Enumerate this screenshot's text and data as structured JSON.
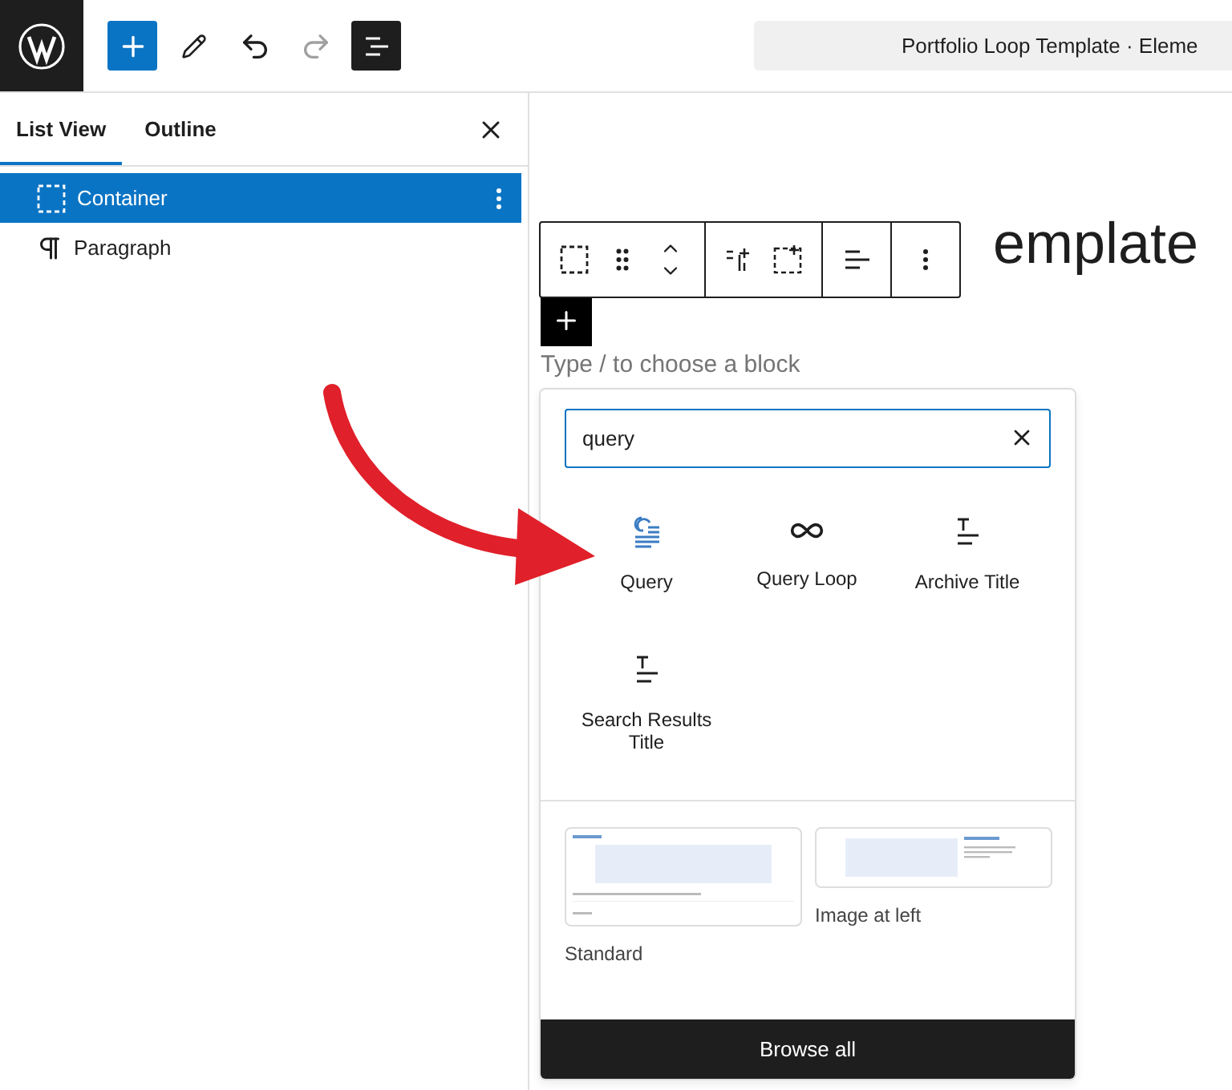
{
  "topbar": {
    "tools": [
      {
        "kind": "inserter"
      },
      {
        "kind": "edit"
      },
      {
        "kind": "undo",
        "disabled": false
      },
      {
        "kind": "redo",
        "disabled": true
      },
      {
        "kind": "list_view",
        "pressed": true
      }
    ],
    "document_title": "Portfolio Loop Template · Eleme"
  },
  "sidebar": {
    "tabs": [
      {
        "label": "List View",
        "selected": true
      },
      {
        "label": "Outline",
        "selected": false
      }
    ],
    "items": [
      {
        "label": "Container",
        "kind": "container",
        "selected": true
      },
      {
        "label": "Paragraph",
        "kind": "paragraph",
        "selected": false
      }
    ]
  },
  "canvas": {
    "heading": "emplate",
    "placeholder": "Type / to choose a block"
  },
  "inserter": {
    "search": "query",
    "blocks": [
      {
        "label": "Query",
        "kind": "query",
        "highlighted": true
      },
      {
        "label": "Query Loop",
        "kind": "loop",
        "highlighted": false
      },
      {
        "label": "Archive Title",
        "kind": "title",
        "highlighted": false
      },
      {
        "label": "Search Results Title",
        "kind": "title",
        "highlighted": false
      }
    ],
    "patterns": [
      {
        "label": "Standard",
        "kind": "standard"
      },
      {
        "label": "Image at left",
        "kind": "image_left"
      }
    ],
    "browse": "Browse all"
  }
}
